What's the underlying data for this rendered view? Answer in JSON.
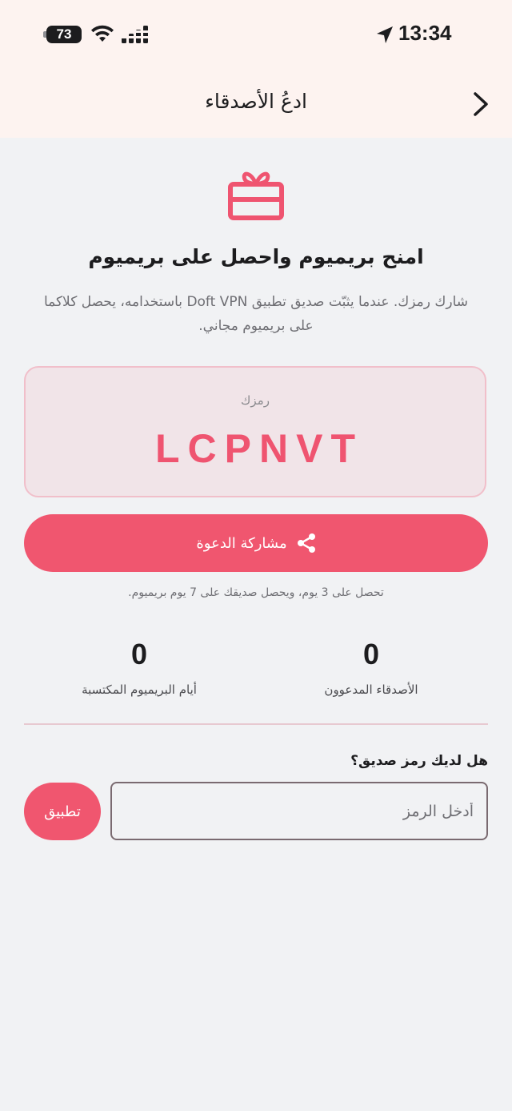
{
  "status_bar": {
    "battery": "73",
    "time": "13:34"
  },
  "nav": {
    "title": "ادعُ الأصدقاء",
    "back_icon": "chevron-right-icon"
  },
  "hero": {
    "icon": "gift-icon",
    "headline": "امنح بريميوم واحصل على بريميوم",
    "description": "شارك رمزك. عندما يثبّت صديق تطبيق Doft VPN باستخدامه، يحصل كلاكما على بريميوم مجاني."
  },
  "code_card": {
    "label": "رمزك",
    "code": "LCPNVT"
  },
  "share": {
    "label": "مشاركة الدعوة",
    "icon": "share-icon"
  },
  "reward_note": "تحصل على 3 يوم، ويحصل صديقك على 7 يوم بريميوم.",
  "stats": {
    "friends_invited": {
      "value": "0",
      "label": "الأصدقاء المدعوون"
    },
    "premium_days": {
      "value": "0",
      "label": "أيام البريميوم المكتسبة"
    }
  },
  "redeem": {
    "question": "هل لديك رمز صديق؟",
    "placeholder": "أدخل الرمز",
    "value": "",
    "apply_label": "تطبيق"
  },
  "colors": {
    "accent": "#f0566f",
    "header_bg": "#fdf3f0",
    "page_bg": "#f1f2f4",
    "code_bg": "#f1e4e8"
  }
}
